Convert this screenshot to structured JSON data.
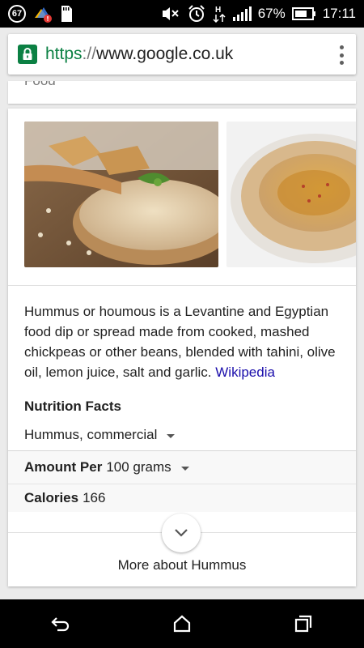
{
  "status_bar": {
    "badge": "67",
    "battery_percent": "67%",
    "time": "17:11",
    "icons_left": [
      "notification-count-icon",
      "weather-alert-icon",
      "sd-card-icon"
    ],
    "icons_right": [
      "mute-icon",
      "alarm-icon",
      "data-transfer-icon",
      "signal-icon",
      "battery-icon"
    ]
  },
  "address_bar": {
    "protocol": "https",
    "separator": "://",
    "host": "www.google.co.uk"
  },
  "knowledge_card": {
    "category": "Food",
    "description": "Hummus or houmous is a Levantine and Egyptian food dip or spread made from cooked, mashed chickpeas or other beans, blended with tahini, olive oil, lemon juice, salt and garlic.",
    "source_link": "Wikipedia",
    "nutrition_title": "Nutrition Facts",
    "nutrition_variant": "Hummus, commercial",
    "amount_label": "Amount Per",
    "amount_value": "100 grams",
    "calories_label": "Calories",
    "calories_value": "166",
    "more_label": "More about Hummus"
  },
  "colors": {
    "secure_green": "#0b8043",
    "link_blue": "#1a0dab"
  }
}
